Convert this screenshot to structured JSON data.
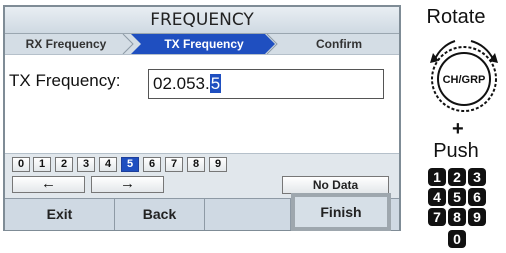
{
  "screen": {
    "title": "FREQUENCY",
    "steps": [
      "RX Frequency",
      "TX Frequency",
      "Confirm"
    ],
    "field_label": "TX Frequency:",
    "field_value_main": "02.053.",
    "field_value_cursor": "5",
    "digits": [
      "0",
      "1",
      "2",
      "3",
      "4",
      "5",
      "6",
      "7",
      "8",
      "9"
    ],
    "selected_digit": "5",
    "left_arrow": "←",
    "right_arrow": "→",
    "no_data": "No Data",
    "softkeys": {
      "exit": "Exit",
      "back": "Back",
      "finish": "Finish"
    }
  },
  "side": {
    "rotate_label": "Rotate",
    "dial_label": "CH/GRP",
    "plus": "+",
    "push_label": "Push",
    "num_keys": [
      "1",
      "2",
      "3",
      "4",
      "5",
      "6",
      "7",
      "8",
      "9",
      "0"
    ]
  },
  "colors": {
    "accent": "#1f4fc0",
    "panel": "#cfd9e3"
  }
}
